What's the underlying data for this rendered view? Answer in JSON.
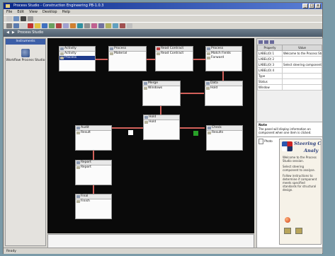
{
  "window": {
    "title": "Process Studio - Construction Engineering PB-1.0.3",
    "controls": [
      "_",
      "□",
      "x"
    ]
  },
  "menu": [
    "File",
    "Edit",
    "View",
    "Desktop",
    "Help"
  ],
  "navbar": {
    "title": "Process Studio",
    "back": "◀",
    "fwd": "▶"
  },
  "left_panel": {
    "header": "Instruments",
    "item_label": "Workflow Process Studio"
  },
  "nodes": [
    {
      "title": "Activity",
      "rows": [
        "Activity",
        "Process"
      ]
    },
    {
      "title": "Process",
      "rows": [
        "Material"
      ]
    },
    {
      "title": "Read Contract",
      "rows": [
        "Read Contract"
      ]
    },
    {
      "title": "Process",
      "rows": [
        "Match Fields",
        "Forward"
      ]
    },
    {
      "title": "Merge",
      "rows": [
        "Windows"
      ]
    },
    {
      "title": "Data",
      "rows": [
        "Hold"
      ]
    },
    {
      "title": "Hold",
      "rows": [
        "Hold"
      ]
    },
    {
      "title": "Check",
      "rows": [
        "Results"
      ]
    },
    {
      "title": "Audit",
      "rows": [
        "Result"
      ]
    },
    {
      "title": "Report",
      "rows": [
        "Report"
      ]
    },
    {
      "title": "Final",
      "rows": [
        "Finish"
      ]
    }
  ],
  "properties": {
    "headers": [
      "Property",
      "Value"
    ],
    "rows": [
      [
        "LABEL(0) 1",
        "Welcome to the Process Studio"
      ],
      [
        "LABEL(0) 2",
        ""
      ],
      [
        "LABEL(0) 3",
        "Select steering component to"
      ],
      [
        "LABEL(0) 4",
        ""
      ],
      [
        "Type",
        ""
      ],
      [
        "Status",
        ""
      ],
      [
        "Window",
        ""
      ]
    ]
  },
  "note": {
    "heading": "Note",
    "text": "The panel will display information on component when one item is clicked."
  },
  "welcome": {
    "list_label": "Photo",
    "title_line1": "Steering Co",
    "title_line2": "Analy",
    "paragraphs": [
      "Welcome to the Process Studio session.",
      "Select steering component to analyse.",
      "Follow instructions to determine if component meets specified standards for structural design."
    ]
  },
  "status": "Ready",
  "colors": {
    "arrow": "#d2605a",
    "canvas_bg": "#0a0a0a",
    "selected_row": "#1f3b8c",
    "marker_white": "#ffffff",
    "marker_green": "#28a028"
  }
}
